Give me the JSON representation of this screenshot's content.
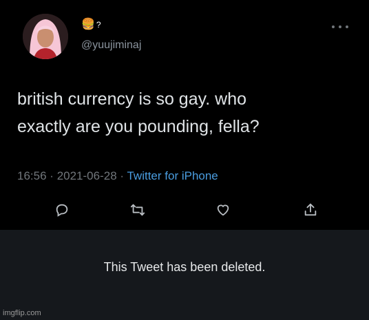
{
  "author": {
    "name_emoji": "🍔",
    "name_suffix": "?",
    "handle": "@yuujiminaj",
    "avatar_icon": "avatar-portrait"
  },
  "tweet": {
    "text": "british currency is so gay. who\nexactly are you pounding, fella?",
    "time": "16:56",
    "separator": "·",
    "date": "2021-06-28",
    "source": "Twitter for iPhone"
  },
  "actions": [
    {
      "name": "reply",
      "icon": "reply-icon"
    },
    {
      "name": "retweet",
      "icon": "retweet-icon"
    },
    {
      "name": "like",
      "icon": "heart-icon"
    },
    {
      "name": "share",
      "icon": "share-icon"
    }
  ],
  "deleted_notice": "This Tweet has been deleted.",
  "watermark": "imgflip.com",
  "colors": {
    "background": "#000000",
    "deleted_panel": "#15181c",
    "muted": "#71767b",
    "link": "#4a9de0"
  }
}
